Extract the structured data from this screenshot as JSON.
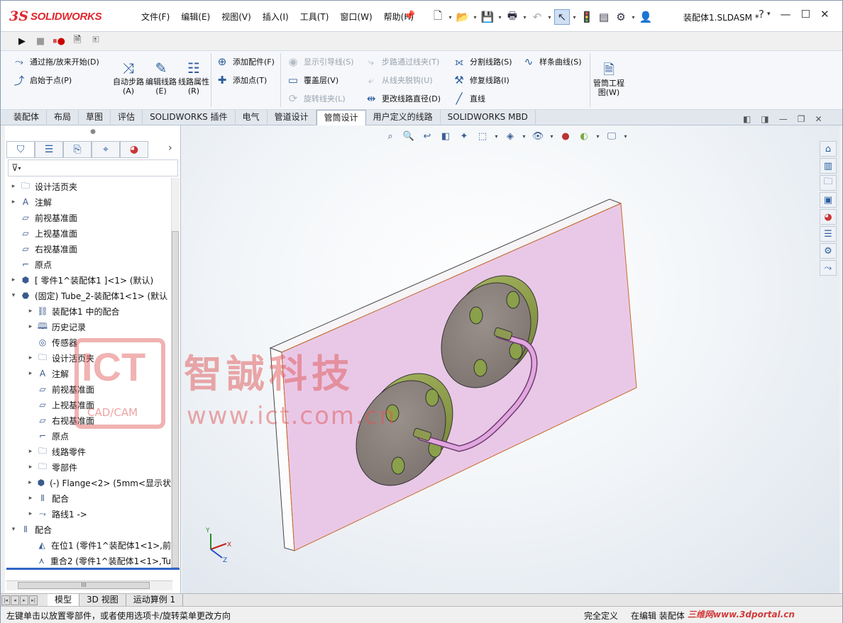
{
  "app": {
    "logo_ds": "3S",
    "logo_name": "SOLIDWORKS",
    "document_title": "装配体1.SLDASM *",
    "help_label": "?"
  },
  "menu": [
    "文件(F)",
    "编辑(E)",
    "视图(V)",
    "插入(I)",
    "工具(T)",
    "窗口(W)",
    "帮助(H)"
  ],
  "commands": {
    "drag_start": "通过拖/放来开始(D)",
    "start_at_point": "启始于点(P)",
    "auto_route": "自动步路(A)",
    "edit_route": "编辑线路(E)",
    "route_props": "线路属性(R)",
    "add_fitting": "添加配件(F)",
    "add_point": "添加点(T)",
    "show_guides": "显示引导线(S)",
    "cover": "覆盖层(V)",
    "rotate_clip": "旋转线夹(L)",
    "route_through_clip": "步路通过线夹(T)",
    "detach_clip": "从线夹脱钩(U)",
    "change_diameter": "更改线路直径(D)",
    "split_route": "分割线路(S)",
    "repair_route": "修复线路(I)",
    "line": "直线",
    "spline": "样条曲线(S)",
    "tube_drawing": "管筒工程图(W)"
  },
  "tabs": [
    {
      "label": "装配体",
      "active": false
    },
    {
      "label": "布局",
      "active": false
    },
    {
      "label": "草图",
      "active": false
    },
    {
      "label": "评估",
      "active": false
    },
    {
      "label": "SOLIDWORKS 插件",
      "active": false
    },
    {
      "label": "电气",
      "active": false
    },
    {
      "label": "管道设计",
      "active": false
    },
    {
      "label": "管筒设计",
      "active": true
    },
    {
      "label": "用户定义的线路",
      "active": false
    },
    {
      "label": "SOLIDWORKS MBD",
      "active": false
    }
  ],
  "tree": [
    {
      "label": "设计活页夹",
      "level": 0,
      "expand": "▸",
      "icon": "folder"
    },
    {
      "label": "注解",
      "level": 0,
      "expand": "▸",
      "icon": "annotation"
    },
    {
      "label": "前视基准面",
      "level": 0,
      "expand": "",
      "icon": "plane"
    },
    {
      "label": "上视基准面",
      "level": 0,
      "expand": "",
      "icon": "plane"
    },
    {
      "label": "右视基准面",
      "level": 0,
      "expand": "",
      "icon": "plane"
    },
    {
      "label": "原点",
      "level": 0,
      "expand": "",
      "icon": "origin"
    },
    {
      "label": "[ 零件1^装配体1 ]<1> (默认)",
      "level": 0,
      "expand": "▸",
      "icon": "part"
    },
    {
      "label": "(固定) Tube_2-装配体1<1> (默认",
      "level": 0,
      "expand": "▾",
      "icon": "assembly"
    },
    {
      "label": "装配体1 中的配合",
      "level": 1,
      "expand": "▸",
      "icon": "mate-folder"
    },
    {
      "label": "历史记录",
      "level": 1,
      "expand": "▸",
      "icon": "history"
    },
    {
      "label": "传感器",
      "level": 1,
      "expand": "",
      "icon": "sensor"
    },
    {
      "label": "设计活页夹",
      "level": 1,
      "expand": "▸",
      "icon": "folder"
    },
    {
      "label": "注解",
      "level": 1,
      "expand": "▸",
      "icon": "annotation"
    },
    {
      "label": "前视基准面",
      "level": 1,
      "expand": "",
      "icon": "plane"
    },
    {
      "label": "上视基准面",
      "level": 1,
      "expand": "",
      "icon": "plane"
    },
    {
      "label": "右视基准面",
      "level": 1,
      "expand": "",
      "icon": "plane"
    },
    {
      "label": "原点",
      "level": 1,
      "expand": "",
      "icon": "origin"
    },
    {
      "label": "线路零件",
      "level": 1,
      "expand": "▸",
      "icon": "folder-blue"
    },
    {
      "label": "零部件",
      "level": 1,
      "expand": "▸",
      "icon": "folder-blue"
    },
    {
      "label": "(-) Flange<2> (5mm<显示状",
      "level": 1,
      "expand": "▸",
      "icon": "part"
    },
    {
      "label": "配合",
      "level": 1,
      "expand": "▸",
      "icon": "mates"
    },
    {
      "label": "路线1 ->",
      "level": 1,
      "expand": "▸",
      "icon": "route"
    },
    {
      "label": "配合",
      "level": 0,
      "expand": "▾",
      "icon": "mates"
    },
    {
      "label": "在位1 (零件1^装配体1<1>,前",
      "level": 1,
      "expand": "",
      "icon": "inplace"
    },
    {
      "label": "重合2 (零件1^装配体1<1>,Tu",
      "level": 1,
      "expand": "",
      "icon": "coincident"
    }
  ],
  "hscroll_label": "III",
  "bottom_tabs": [
    {
      "label": "模型",
      "active": true
    },
    {
      "label": "3D 视图",
      "active": false
    },
    {
      "label": "运动算例 1",
      "active": false
    }
  ],
  "status": {
    "hint": "左键单击以放置零部件，或者使用选项卡/旋转菜单更改方向",
    "definition": "完全定义",
    "editing": "在编辑 装配体",
    "watermark_url": "三维网www.3dportal.cn"
  },
  "watermark": {
    "logo": "ICT",
    "logo_sub": "CAD/CAM",
    "company": "智誠科技",
    "url": "www.ict.com.cn"
  },
  "triad": {
    "x": "X",
    "y": "Y",
    "z": "Z"
  },
  "colors": {
    "plate_face": "#e8c6e6",
    "plate_edge": "#f3eef3",
    "flange_rim": "#8a9a4a",
    "flange_face": "#8f8580",
    "tube": "#d58ad3",
    "watermark_red": "#e05555"
  }
}
